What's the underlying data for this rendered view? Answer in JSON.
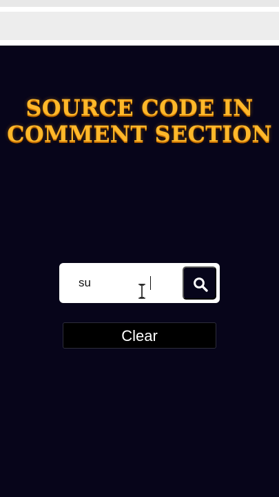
{
  "title": {
    "line1": "SOURCE CODE IN",
    "line2": "COMMENT SECTION"
  },
  "search": {
    "value": "su"
  },
  "buttons": {
    "clear_label": "Clear"
  },
  "icons": {
    "search": "search-icon",
    "text_cursor": "i-beam-cursor-icon"
  },
  "colors": {
    "background": "#07051a",
    "title": "#ffb82a",
    "title_shadow": "#c46b00",
    "input_background": "#ffffff",
    "button_background": "#07051a",
    "clear_border": "#2d2d3b"
  }
}
